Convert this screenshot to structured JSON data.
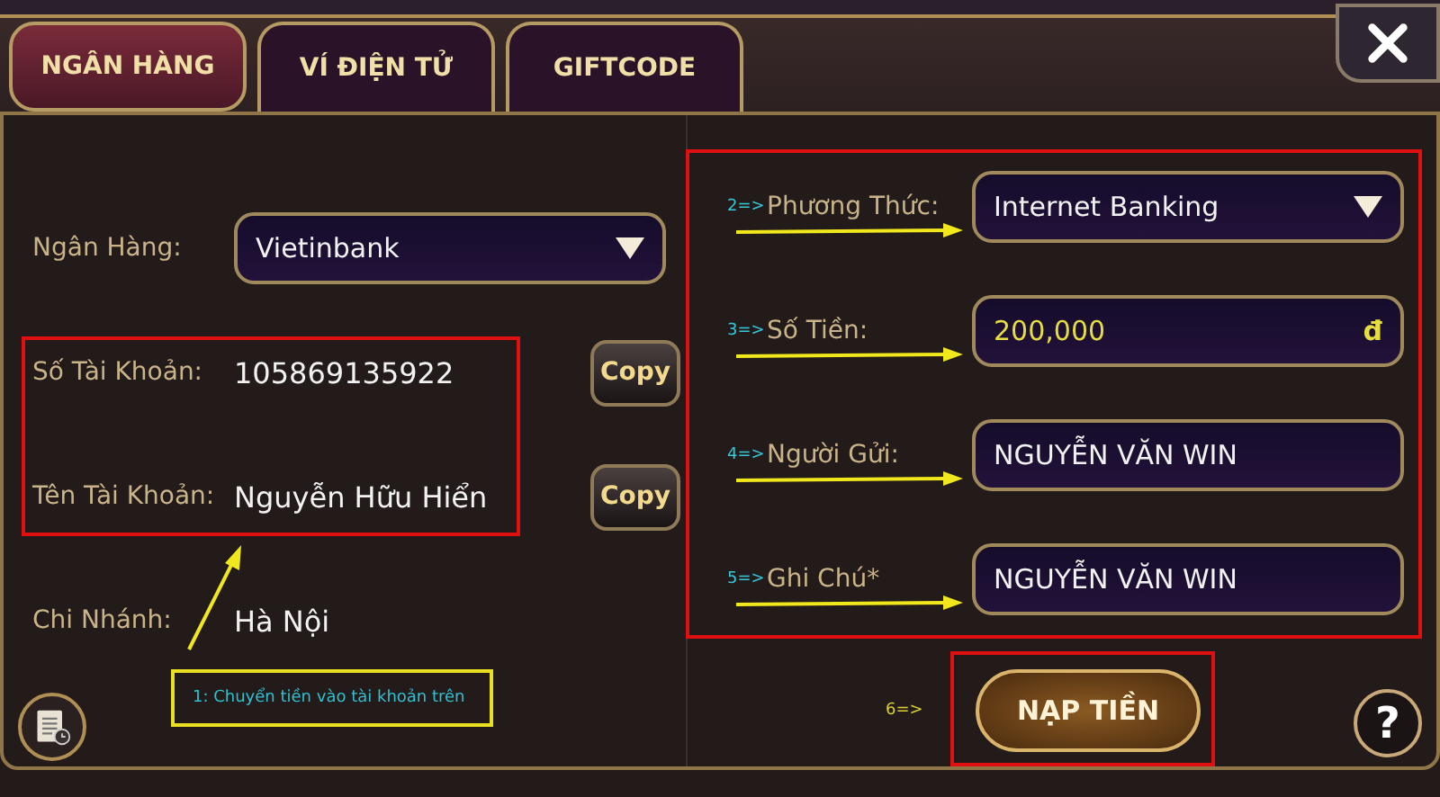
{
  "tabs": [
    {
      "label": "NGÂN HÀNG",
      "selected": true
    },
    {
      "label": "VÍ ĐIỆN TỬ",
      "selected": false
    },
    {
      "label": "GIFTCODE",
      "selected": false
    }
  ],
  "bank_form": {
    "rows": [
      {
        "kind": "dropdown",
        "label": "Ngân Hàng:",
        "value": "Vietinbank"
      },
      {
        "kind": "copy",
        "label": "Số Tài Khoản:",
        "value": "105869135922",
        "button": "Copy"
      },
      {
        "kind": "copy",
        "label": "Tên Tài Khoản:",
        "value": "Nguyễn Hữu Hiển",
        "button": "Copy"
      },
      {
        "kind": "text",
        "label": "Chi Nhánh:",
        "value": "Hà Nội"
      }
    ]
  },
  "note": "1: Chuyển tiền vào tài khoản trên",
  "deposit_form": {
    "rows": [
      {
        "kind": "dropdown",
        "step": "2=>",
        "label": "Phương Thức:",
        "value": "Internet Banking"
      },
      {
        "kind": "amount",
        "step": "3=>",
        "label": "Số Tiền:",
        "value": "200,000",
        "unit": "đ"
      },
      {
        "kind": "input",
        "step": "4=>",
        "label": "Người Gửi:",
        "value": "NGUYỄN VĂN WIN"
      },
      {
        "kind": "input",
        "step": "5=>",
        "label": "Ghi Chú*",
        "value": "NGUYỄN VĂN WIN"
      }
    ]
  },
  "submit": {
    "step": "6=>",
    "label": "NẠP TIỀN"
  },
  "help_button": "?"
}
